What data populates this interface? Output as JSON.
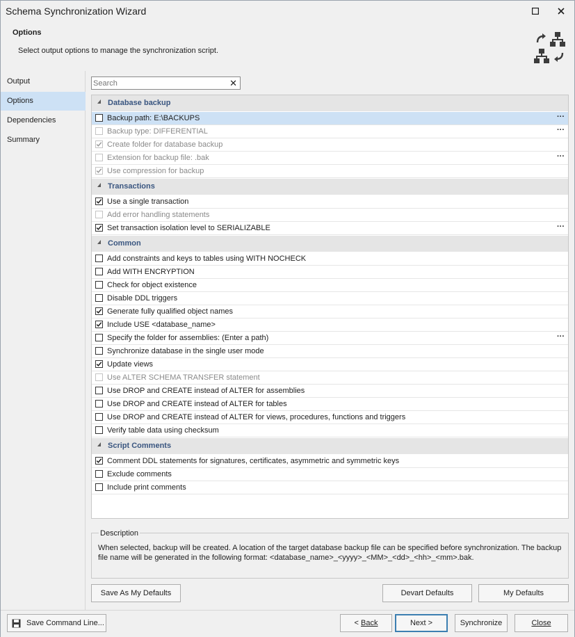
{
  "window": {
    "title": "Schema Synchronization Wizard",
    "maximize_icon": "maximize-icon",
    "close_icon": "close-icon"
  },
  "header": {
    "title": "Options",
    "description": "Select output options to manage the synchronization script.",
    "icon": "schema-sync-icon"
  },
  "sidebar": {
    "items": [
      {
        "label": "Output"
      },
      {
        "label": "Options"
      },
      {
        "label": "Dependencies"
      },
      {
        "label": "Summary"
      }
    ],
    "active_index": 1
  },
  "search": {
    "placeholder": "Search",
    "value": "",
    "clear_icon": "clear-icon"
  },
  "groups": [
    {
      "label": "Database backup",
      "rows": [
        {
          "label": "Backup path: E:\\BACKUPS",
          "checked": false,
          "enabled": true,
          "selected": true,
          "ellipsis": "···"
        },
        {
          "label": "Backup type: DIFFERENTIAL",
          "checked": false,
          "enabled": false,
          "ellipsis": "···"
        },
        {
          "label": "Create folder for database backup",
          "checked": true,
          "enabled": false
        },
        {
          "label": "Extension for backup file: .bak",
          "checked": false,
          "enabled": false,
          "ellipsis": "···"
        },
        {
          "label": "Use compression for backup",
          "checked": true,
          "enabled": false
        }
      ]
    },
    {
      "label": "Transactions",
      "rows": [
        {
          "label": "Use a single transaction",
          "checked": true,
          "enabled": true
        },
        {
          "label": "Add error handling statements",
          "checked": false,
          "enabled": false
        },
        {
          "label": "Set transaction isolation level to SERIALIZABLE",
          "checked": true,
          "enabled": true,
          "ellipsis": "···"
        }
      ]
    },
    {
      "label": "Common",
      "rows": [
        {
          "label": "Add constraints and keys to tables using WITH NOCHECK",
          "checked": false,
          "enabled": true
        },
        {
          "label": "Add WITH ENCRYPTION",
          "checked": false,
          "enabled": true
        },
        {
          "label": "Check for object existence",
          "checked": false,
          "enabled": true
        },
        {
          "label": "Disable DDL triggers",
          "checked": false,
          "enabled": true
        },
        {
          "label": "Generate fully qualified object names",
          "checked": true,
          "enabled": true
        },
        {
          "label": "Include USE <database_name>",
          "checked": true,
          "enabled": true
        },
        {
          "label": "Specify the folder for assemblies: (Enter a path)",
          "checked": false,
          "enabled": true,
          "ellipsis": "···"
        },
        {
          "label": "Synchronize database in the single user mode",
          "checked": false,
          "enabled": true
        },
        {
          "label": "Update views",
          "checked": true,
          "enabled": true
        },
        {
          "label": "Use ALTER SCHEMA TRANSFER statement",
          "checked": false,
          "enabled": false
        },
        {
          "label": "Use DROP and CREATE instead of ALTER for assemblies",
          "checked": false,
          "enabled": true
        },
        {
          "label": "Use DROP and CREATE instead of ALTER for tables",
          "checked": false,
          "enabled": true
        },
        {
          "label": "Use DROP and CREATE instead of ALTER for views, procedures, functions and triggers",
          "checked": false,
          "enabled": true
        },
        {
          "label": "Verify table data using checksum",
          "checked": false,
          "enabled": true
        }
      ]
    },
    {
      "label": "Script Comments",
      "rows": [
        {
          "label": "Comment DDL statements for signatures, certificates, asymmetric and symmetric keys",
          "checked": true,
          "enabled": true
        },
        {
          "label": "Exclude comments",
          "checked": false,
          "enabled": true
        },
        {
          "label": "Include print comments",
          "checked": false,
          "enabled": true
        }
      ]
    }
  ],
  "description": {
    "title": "Description",
    "text": "When selected, backup will be created. A location of the target database backup file can be specified before synchronization. The backup file name will be generated in the following format: <database_name>_<yyyy>_<MM>_<dd>_<hh>_<mm>.bak."
  },
  "defaults_buttons": {
    "save_as_my_defaults": "Save As My Defaults",
    "devart_defaults": "Devart Defaults",
    "my_defaults": "My Defaults"
  },
  "footer": {
    "save_command_line": "Save Command Line...",
    "save_icon": "floppy-disk-icon",
    "back_prefix": "< ",
    "back_label": "Back",
    "next_label": "Next >",
    "synchronize_label": "Synchronize",
    "close_label": "Close"
  }
}
